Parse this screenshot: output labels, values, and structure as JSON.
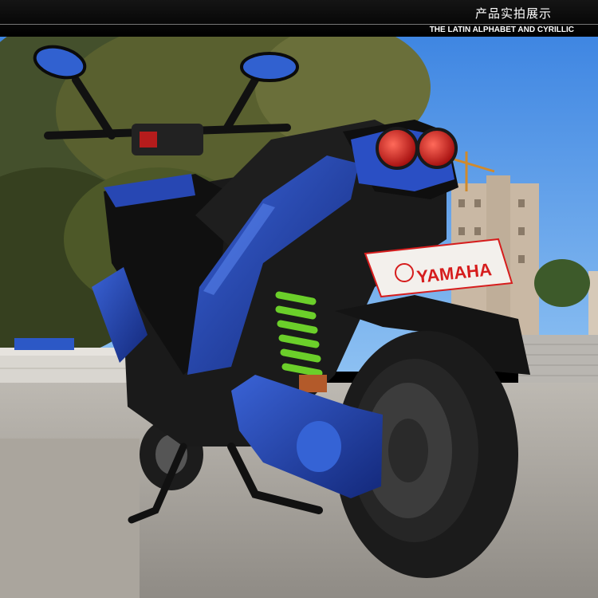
{
  "banner": {
    "title": "产品实拍展示",
    "subtitle": "THE LATIN ALPHABET AND CYRILLIC"
  },
  "photo": {
    "subject": "blue-scooter",
    "plate_text": "YAMAHA",
    "colors": {
      "body_blue": "#1f3fa8",
      "spring_green": "#6bcf2a",
      "tail_light_red": "#d21a1a",
      "sky": "#4f93e6"
    }
  }
}
